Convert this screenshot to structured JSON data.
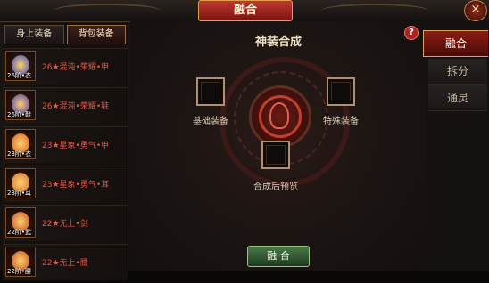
{
  "window": {
    "title": "融合",
    "close_glyph": "×"
  },
  "left_panel": {
    "tabs": [
      {
        "label": "身上装备",
        "active": false
      },
      {
        "label": "背包装备",
        "active": true
      }
    ],
    "items": [
      {
        "name": "26★混沌•荣耀•甲",
        "level": "26阶•衣",
        "gem_color": "#3a4ac0"
      },
      {
        "name": "26★混沌•荣耀•鞋",
        "level": "26阶•鞋",
        "gem_color": "#4a3ab0"
      },
      {
        "name": "23★星象•勇气•甲",
        "level": "23阶•衣",
        "gem_color": "#d06020"
      },
      {
        "name": "23★星象•勇气•耳",
        "level": "23阶•耳",
        "gem_color": "#d07030"
      },
      {
        "name": "22★无上•剑",
        "level": "22阶•武",
        "gem_color": "#c04a20"
      },
      {
        "name": "22★无上•腰",
        "level": "22阶•腰",
        "gem_color": "#c05020"
      }
    ]
  },
  "center_panel": {
    "title": "神装合成",
    "help_glyph": "?",
    "base_slot_label": "基础装备",
    "special_slot_label": "特殊装备",
    "preview_slot_label": "合成后预览",
    "fuse_button_label": "融 合"
  },
  "right_tabs": [
    {
      "label": "融合",
      "active": true
    },
    {
      "label": "拆分",
      "active": false
    },
    {
      "label": "通灵",
      "active": false
    }
  ],
  "colors": {
    "accent_red": "#8a1e14",
    "item_name_red": "#e45545",
    "fuse_green": "#3a6a3a"
  }
}
